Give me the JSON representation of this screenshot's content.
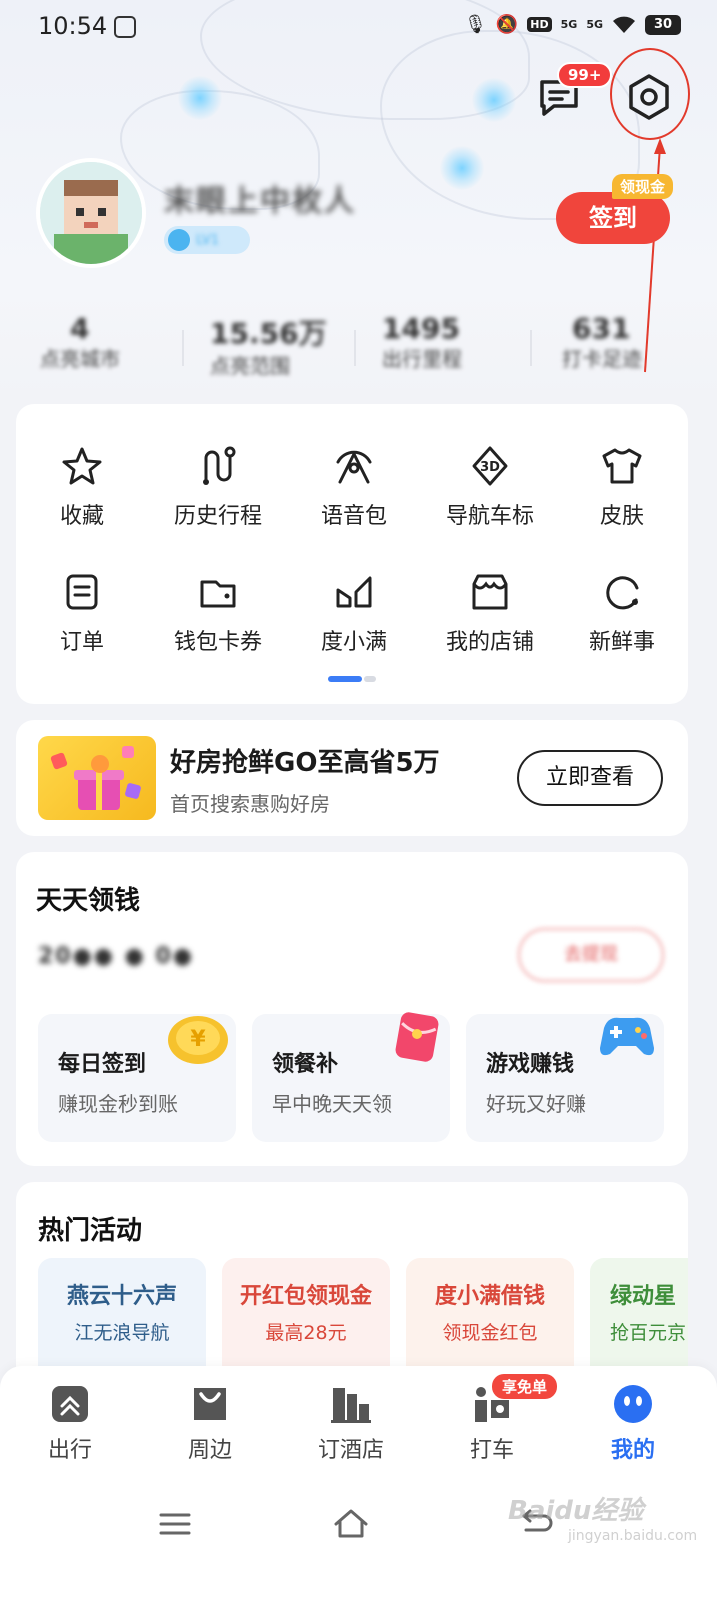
{
  "status_bar": {
    "time": "10:54",
    "network_a": "5G",
    "network_b": "5G",
    "hd": "HD",
    "battery": "30"
  },
  "header": {
    "message_badge": "99+",
    "username": "末眼上中枚人",
    "level": "LV1",
    "signin_label": "签到",
    "cash_tag": "领现金"
  },
  "stats": [
    {
      "value": "4",
      "label": "点亮城市"
    },
    {
      "value": "15.56万",
      "label": "点亮范围"
    },
    {
      "value": "1495",
      "label": "出行里程"
    },
    {
      "value": "631",
      "label": "打卡足迹"
    }
  ],
  "grid": {
    "items": [
      {
        "label": "收藏",
        "icon": "star-icon"
      },
      {
        "label": "历史行程",
        "icon": "route-icon"
      },
      {
        "label": "语音包",
        "icon": "voice-pack-icon"
      },
      {
        "label": "导航车标",
        "icon": "3d-car-icon"
      },
      {
        "label": "皮肤",
        "icon": "tshirt-icon"
      },
      {
        "label": "订单",
        "icon": "order-icon"
      },
      {
        "label": "钱包卡券",
        "icon": "wallet-icon"
      },
      {
        "label": "度小满",
        "icon": "duxiaoman-icon"
      },
      {
        "label": "我的店铺",
        "icon": "shop-icon"
      },
      {
        "label": "新鲜事",
        "icon": "news-icon"
      }
    ]
  },
  "promo": {
    "title": "好房抢鲜GO至高省5万",
    "subtitle": "首页搜索惠购好房",
    "button": "立即查看"
  },
  "money": {
    "title": "天天领钱",
    "balance_blur": "20●● ● 0●",
    "right_blur": "去提现",
    "tasks": [
      {
        "title": "每日签到",
        "sub": "赚现金秒到账"
      },
      {
        "title": "领餐补",
        "sub": "早中晚天天领"
      },
      {
        "title": "游戏赚钱",
        "sub": "好玩又好赚"
      }
    ]
  },
  "hot": {
    "title": "热门活动",
    "items": [
      {
        "title": "燕云十六声",
        "sub": "江无浪导航",
        "color": "#2e5d8a",
        "bg": "#eef4fb"
      },
      {
        "title": "开红包领现金",
        "sub": "最高28元",
        "color": "#d9473a",
        "bg": "#fdf0ee"
      },
      {
        "title": "度小满借钱",
        "sub": "领现金红包",
        "color": "#d9473a",
        "bg": "#fdf2ec"
      },
      {
        "title": "绿动星",
        "sub": "抢百元京",
        "color": "#3e8e3a",
        "bg": "#eef7ec"
      }
    ]
  },
  "bottom_nav": {
    "items": [
      {
        "label": "出行"
      },
      {
        "label": "周边"
      },
      {
        "label": "订酒店"
      },
      {
        "label": "打车"
      },
      {
        "label": "我的"
      }
    ],
    "free_tag": "享免单"
  },
  "watermark": {
    "main": "Baidu经验",
    "sub": "jingyan.baidu.com"
  },
  "colors": {
    "accent_blue": "#2a6ff2",
    "signin_red": "#f0453c",
    "annotation_red": "#e23a2c"
  }
}
